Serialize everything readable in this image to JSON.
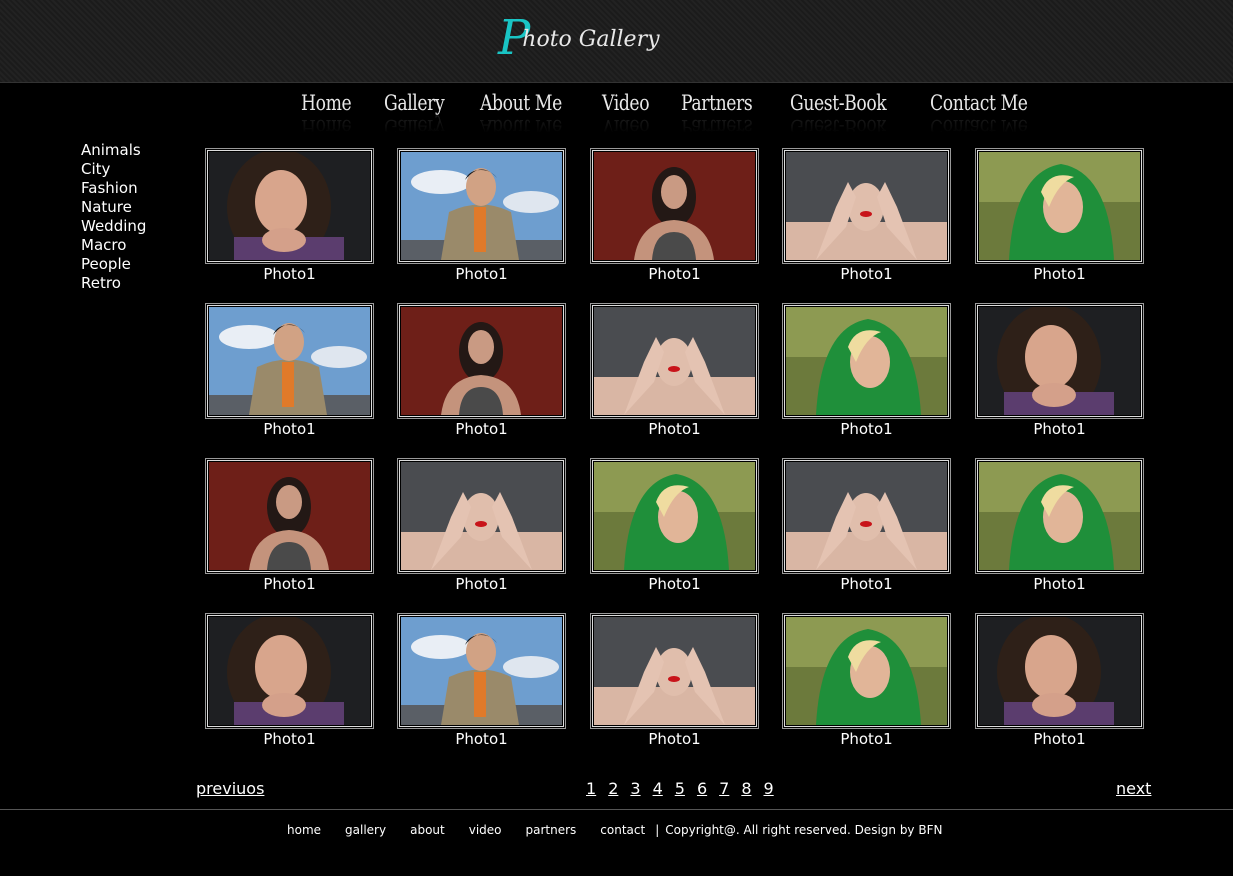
{
  "logo": {
    "initial": "P",
    "rest": "hoto Gallery",
    "accent_color": "#19c4c4"
  },
  "topnav": [
    {
      "label": "Home"
    },
    {
      "label": "Gallery"
    },
    {
      "label": "About Me"
    },
    {
      "label": "Video"
    },
    {
      "label": "Partners"
    },
    {
      "label": "Guest-Book"
    },
    {
      "label": "Contact Me"
    }
  ],
  "sidebar": [
    "Animals",
    "City",
    "Fashion",
    "Nature",
    "Wedding",
    "Macro",
    "People",
    "Retro"
  ],
  "gallery": {
    "caption": "Photo1",
    "rows": [
      [
        "girl-dark",
        "man-sky",
        "woman-red",
        "face-hands",
        "green-hood"
      ],
      [
        "man-sky",
        "woman-red",
        "face-hands",
        "green-hood",
        "girl-dark"
      ],
      [
        "woman-red",
        "face-hands",
        "green-hood",
        "face-hands",
        "green-hood"
      ],
      [
        "girl-dark",
        "man-sky",
        "face-hands",
        "green-hood",
        "girl-dark"
      ]
    ]
  },
  "pager": {
    "prev": "previuos",
    "next": "next",
    "pages": [
      "1",
      "2",
      "3",
      "4",
      "5",
      "6",
      "7",
      "8",
      "9"
    ]
  },
  "footer": {
    "links": [
      "home",
      "gallery",
      "about",
      "video",
      "partners",
      "contact"
    ],
    "separator": "|",
    "copyright": "Copyright@. All right reserved. Design by BFN"
  }
}
